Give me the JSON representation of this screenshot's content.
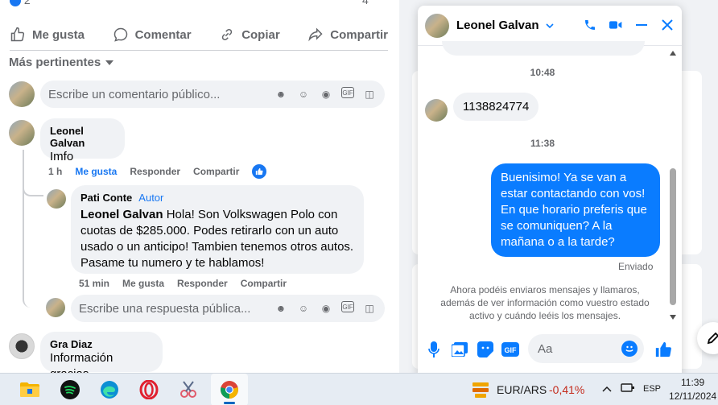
{
  "post": {
    "reaction_count": "2",
    "comment_count": "4",
    "actions": [
      {
        "label": "Me gusta",
        "icon": "thumbs-up-icon"
      },
      {
        "label": "Comentar",
        "icon": "comment-icon"
      },
      {
        "label": "Copiar",
        "icon": "link-icon"
      },
      {
        "label": "Compartir",
        "icon": "share-icon"
      }
    ],
    "sort_label": "Más pertinentes",
    "comment_placeholder": "Escribe un comentario público..."
  },
  "comments": [
    {
      "name": "Leonel Galvan",
      "text": "Imfo",
      "time": "1 h",
      "like": "Me gusta",
      "reply": "Responder",
      "share": "Compartir"
    },
    {
      "name": "Pati Conte",
      "badge": "Autor",
      "mention": "Leonel Galvan",
      "text": " Hola! Son Volkswagen Polo con cuotas de $285.000. Podes retirarlo con un auto usado o un anticipo! Tambien tenemos otros autos. Pasame tu numero y te hablamos!",
      "time": "51 min",
      "like": "Me gusta",
      "reply": "Responder",
      "share": "Compartir"
    },
    {
      "name": "Gra Diaz",
      "text": "Información gracias"
    }
  ],
  "reply_placeholder": "Escribe una respuesta pública...",
  "chat": {
    "contact": "Leonel Galvan",
    "time1": "10:48",
    "msg_in": "1138824774",
    "time2": "11:38",
    "msg_out": "Buenisimo! Ya se van a estar contactando con vos! En que horario preferis que se comuniquen? A la mañana o a la tarde?",
    "status": "Enviado",
    "notice": "Ahora podéis enviaros mensajes y llamaros, además de ver información como vuestro estado activo y cuándo leéis los mensajes.",
    "input_placeholder": "Aa",
    "accent": "#0a7cff"
  },
  "taskbar": {
    "ticker": "EUR/ARS",
    "change": "-0,41%",
    "lang": "ESP",
    "time": "11:39",
    "date": "12/11/2024"
  }
}
